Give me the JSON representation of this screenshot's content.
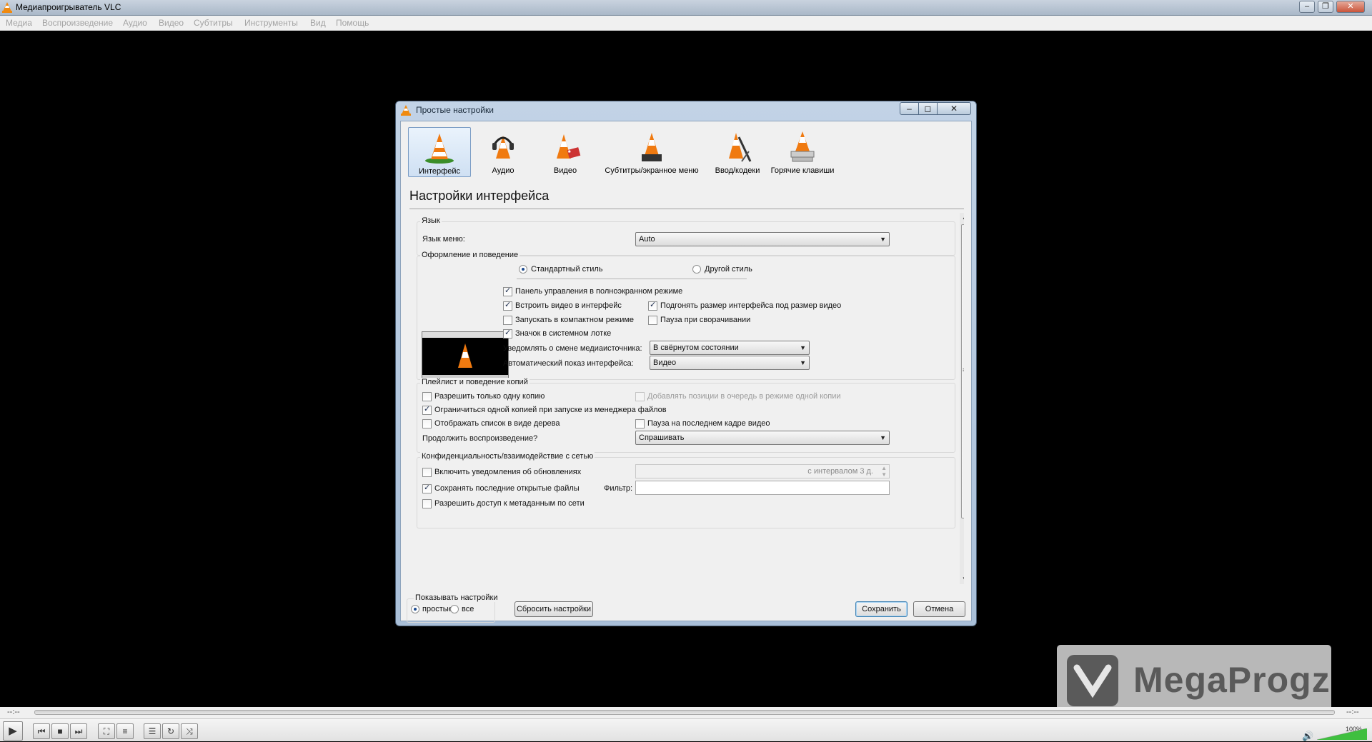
{
  "window": {
    "title": "Медиапроигрыватель VLC",
    "controls": [
      "–",
      "❐",
      "✕"
    ]
  },
  "menu": [
    "Медиа",
    "Воспроизведение",
    "Аудио",
    "Видео",
    "Субтитры",
    "Инструменты",
    "Вид",
    "Помощь"
  ],
  "player": {
    "time_elapsed": "--:--",
    "time_total": "--:--",
    "volume": "100%",
    "volume_level": 1.0
  },
  "watermark": "MegaProgz",
  "dialog": {
    "title": "Простые настройки",
    "categories": [
      {
        "label": "Интерфейс",
        "icon": "interface-cone-icon",
        "selected": true
      },
      {
        "label": "Аудио",
        "icon": "headphones-cone-icon"
      },
      {
        "label": "Видео",
        "icon": "video-cone-icon"
      },
      {
        "label": "Субтитры/экранное меню",
        "icon": "subtitles-cone-icon"
      },
      {
        "label": "Ввод/кодеки",
        "icon": "input-codecs-cone-icon"
      },
      {
        "label": "Горячие клавиши",
        "icon": "hotkeys-cone-icon"
      }
    ],
    "pane_title": "Настройки интерфейса",
    "language": {
      "group": "Язык",
      "label": "Язык меню:",
      "value": "Auto"
    },
    "look": {
      "group": "Оформление и поведение",
      "native_style": "Стандартный стиль",
      "skins_style": "Другой стиль",
      "fullscreen_controls": "Панель управления в полноэкранном режиме",
      "embed_video": "Встроить видео в интерфейс",
      "resize_interface": "Подгонять размер интерфейса под размер видео",
      "minimal_mode": "Запускать в компактном режиме",
      "pause_minimized": "Пауза при сворачивании",
      "systray_icon": "Значок в системном лотке",
      "notify_label": "Уведомлять о смене медиаисточника:",
      "notify_value": "В свёрнутом состоянии",
      "autoraise_label": "Автоматический показ интерфейса:",
      "autoraise_value": "Видео"
    },
    "playlist": {
      "group": "Плейлист и поведение копий",
      "one_instance": "Разрешить только одну копию",
      "enqueue": "Добавлять позиции в очередь в режиме одной копии",
      "one_instance_fm": "Ограничиться одной копией при запуске из менеджера файлов",
      "tree_view": "Отображать список в виде дерева",
      "pause_last_frame": "Пауза на последнем кадре видео",
      "continue_label": "Продолжить воспроизведение?",
      "continue_value": "Спрашивать"
    },
    "privacy": {
      "group": "Конфиденциальность/взаимодействие с сетью",
      "updates": "Включить уведомления об обновлениях",
      "updates_interval": "с интервалом 3 д.",
      "recent_files": "Сохранять последние открытые файлы",
      "filter_label": "Фильтр:",
      "filter_value": "",
      "metadata_access": "Разрешить доступ к метаданным по сети"
    },
    "show_settings": {
      "label": "Показывать настройки",
      "simple": "простые",
      "all": "все"
    },
    "buttons": {
      "reset": "Сбросить настройки",
      "save": "Сохранить",
      "cancel": "Отмена"
    }
  },
  "colors": {
    "dialog_frame": "#b4c8de",
    "accent_orange": "#f07a10"
  }
}
